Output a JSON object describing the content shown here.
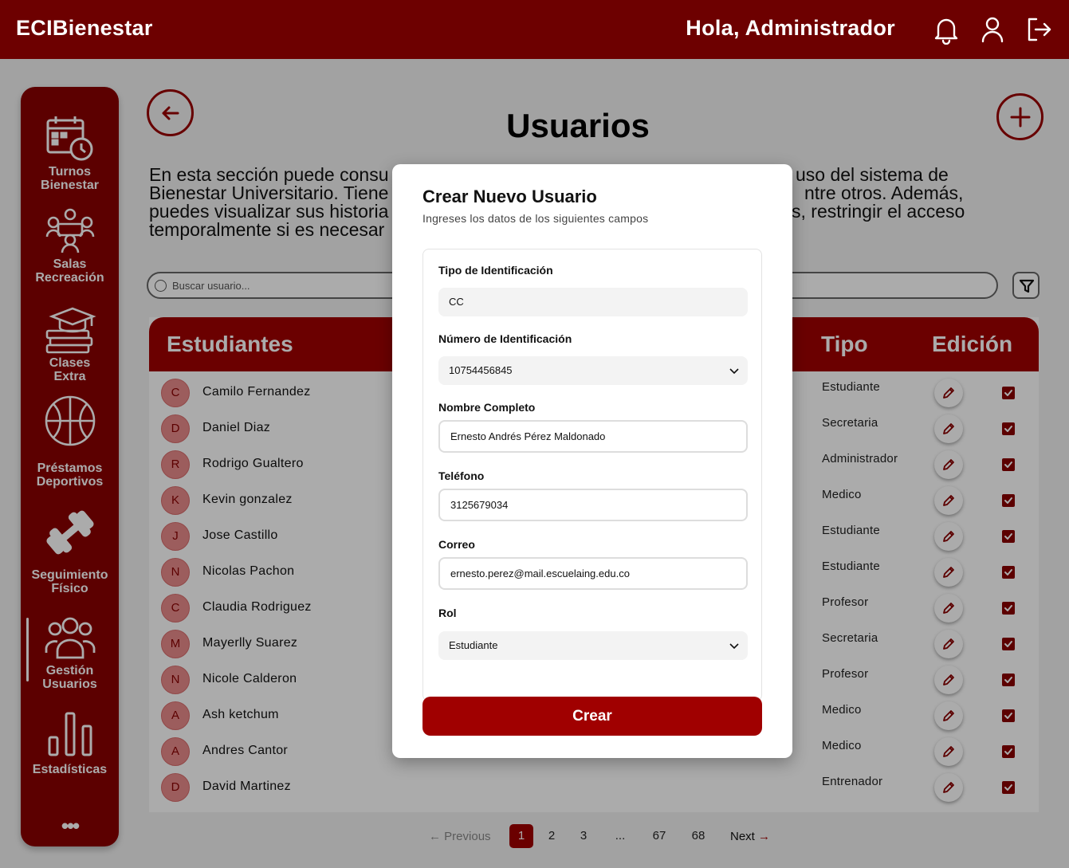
{
  "header": {
    "brand": "ECIBienestar",
    "greeting": "Hola, Administrador"
  },
  "sidebar": {
    "items": [
      {
        "label": "Turnos\nBienestar",
        "icon": "calendar-clock-icon"
      },
      {
        "label": "Salas\nRecreación",
        "icon": "meeting-room-icon"
      },
      {
        "label": "Clases\nExtra",
        "icon": "graduation-books-icon"
      },
      {
        "label": "Préstamos\nDeportivos",
        "icon": "basketball-icon"
      },
      {
        "label": "Seguimiento\nFísico",
        "icon": "dumbbell-icon"
      },
      {
        "label": "Gestión\nUsuarios",
        "icon": "users-group-icon"
      },
      {
        "label": "Estadísticas",
        "icon": "bar-chart-icon"
      }
    ],
    "more": "•••"
  },
  "page": {
    "title": "Usuarios",
    "intro": "En esta sección puede consu… uso del sistema de Bienestar Universitario. Tiene… ntre otros. Además, puedes visualizar sus historia… s, restringir el acceso temporalmente si es necesar…",
    "intro_lines": [
      "En esta sección puede consu",
      "Bienestar Universitario. Tiene",
      "puedes visualizar sus historia",
      "temporalmente si es necesar",
      "uso del sistema de",
      "ntre otros. Además,",
      "s, restringir el acceso"
    ],
    "search_placeholder": "Buscar usuario..."
  },
  "table": {
    "headers": {
      "name": "Estudiantes",
      "type": "Tipo",
      "edit": "Edición"
    },
    "rows": [
      {
        "initial": "C",
        "name": "Camilo Fernandez",
        "type": "Estudiante"
      },
      {
        "initial": "D",
        "name": "Daniel Diaz",
        "type": "Secretaria"
      },
      {
        "initial": "R",
        "name": "Rodrigo Gualtero",
        "type": "Administrador"
      },
      {
        "initial": "K",
        "name": "Kevin gonzalez",
        "type": "Medico"
      },
      {
        "initial": "J",
        "name": "Jose Castillo",
        "type": "Estudiante"
      },
      {
        "initial": "N",
        "name": "Nicolas Pachon",
        "type": "Estudiante"
      },
      {
        "initial": "C",
        "name": "Claudia Rodriguez",
        "type": "Profesor"
      },
      {
        "initial": "M",
        "name": "Mayerlly Suarez",
        "type": "Secretaria"
      },
      {
        "initial": "N",
        "name": "Nicole Calderon",
        "type": "Profesor"
      },
      {
        "initial": "A",
        "name": "Ash ketchum",
        "type": "Medico"
      },
      {
        "initial": "A",
        "name": "Andres Cantor",
        "type": "Medico"
      },
      {
        "initial": "D",
        "name": "David Martinez",
        "type": "Entrenador"
      }
    ]
  },
  "pagination": {
    "previous": "Previous",
    "next": "Next",
    "pages": [
      "1",
      "2",
      "3",
      "...",
      "67",
      "68"
    ],
    "current": "1"
  },
  "modal": {
    "title": "Crear Nuevo Usuario",
    "subtitle": "Ingreses los datos de los siguientes campos",
    "fields": {
      "id_type_label": "Tipo de Identificación",
      "id_type_value": "CC",
      "id_number_label": "Número de Identificación",
      "id_number_value": "10754456845",
      "name_label": "Nombre Completo",
      "name_value": "Ernesto Andrés Pérez Maldonado",
      "phone_label": "Teléfono",
      "phone_value": "3125679034",
      "email_label": "Correo",
      "email_value": "ernesto.perez@mail.escuelaing.edu.co",
      "role_label": "Rol",
      "role_value": "Estudiante"
    },
    "submit_label": "Crear"
  },
  "colors": {
    "primary": "#6d0000",
    "accent": "#a00000",
    "avatar": "#e98b8b"
  }
}
